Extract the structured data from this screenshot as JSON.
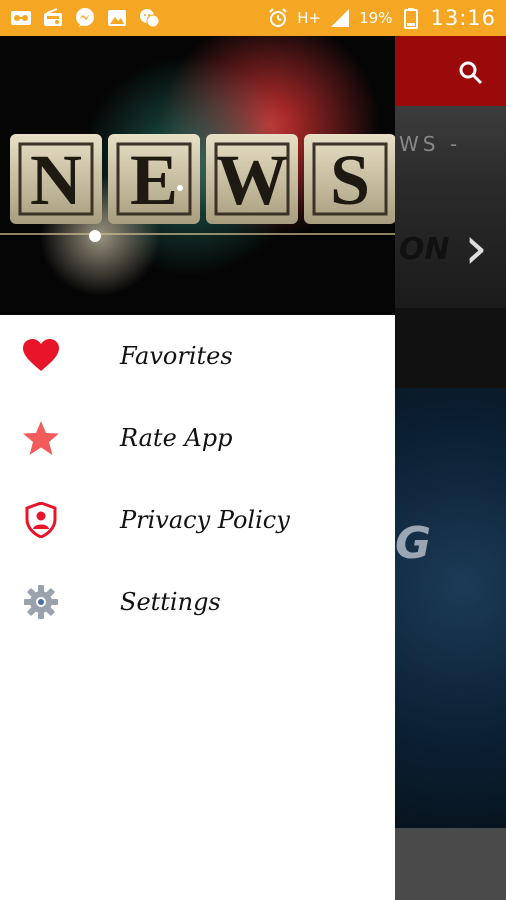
{
  "status_bar": {
    "battery": "19%",
    "time": "13:16",
    "signal_label": "H+",
    "bg_color": "#f5a623",
    "left_icons": [
      "voicemail-icon",
      "radio-icon",
      "messenger-icon",
      "gallery-icon",
      "wechat-icon"
    ],
    "right_icons": [
      "alarm-icon",
      "network-h-plus-icon",
      "signal-icon",
      "battery-icon"
    ]
  },
  "drawer": {
    "header_text": "NEWS",
    "menu": [
      {
        "label": "Favorites",
        "icon": "heart-icon",
        "color": "#e8142a"
      },
      {
        "label": "Rate App",
        "icon": "star-icon",
        "color": "#f25b5b"
      },
      {
        "label": "Privacy Policy",
        "icon": "shield-user-icon",
        "color": "#e8142a"
      },
      {
        "label": "Settings",
        "icon": "gear-icon",
        "color": "#9aa3ad"
      }
    ]
  },
  "background_app": {
    "toolbar_color": "#9b0a0a",
    "search_icon": "search-icon",
    "banner_text": "WS -",
    "banner_text2": "ON",
    "tech_letter": "G"
  }
}
